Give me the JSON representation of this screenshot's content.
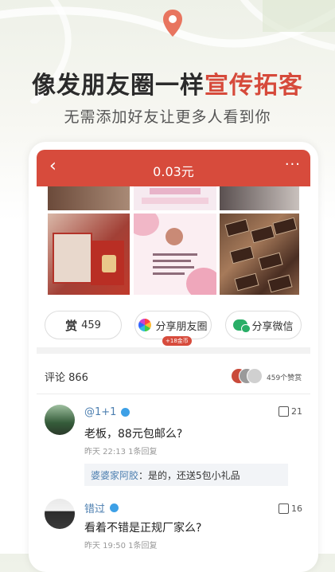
{
  "banner": {
    "headline_main": "像发朋友圈一样",
    "headline_highlight": "宣传拓客",
    "subline": "无需添加好友让更多人看到你",
    "accent": "#d64a3b"
  },
  "topbar": {
    "back_icon": "back-chevron-icon",
    "title": "0.03元",
    "more_icon": "more-dots-icon",
    "bg": "#d74b3c"
  },
  "actions": {
    "reward_icon": "赏",
    "reward_count": "459",
    "share_moments": "分享朋友圈",
    "share_moments_tag": "+18金币",
    "share_wechat": "分享微信"
  },
  "comments_header": {
    "label": "评论 866",
    "likers": "459个赞赏"
  },
  "comments": [
    {
      "user": "@1+1",
      "text": "老板，88元包邮么?",
      "meta": "昨天 22:13 1条回复",
      "likes": "21",
      "reply": {
        "name": "婆婆家阿胶",
        "text": "是的，还送5包小礼品"
      }
    },
    {
      "user": "错过",
      "text": "看着不错是正规厂家么?",
      "meta": "昨天 19:50 1条回复",
      "likes": "16"
    }
  ]
}
